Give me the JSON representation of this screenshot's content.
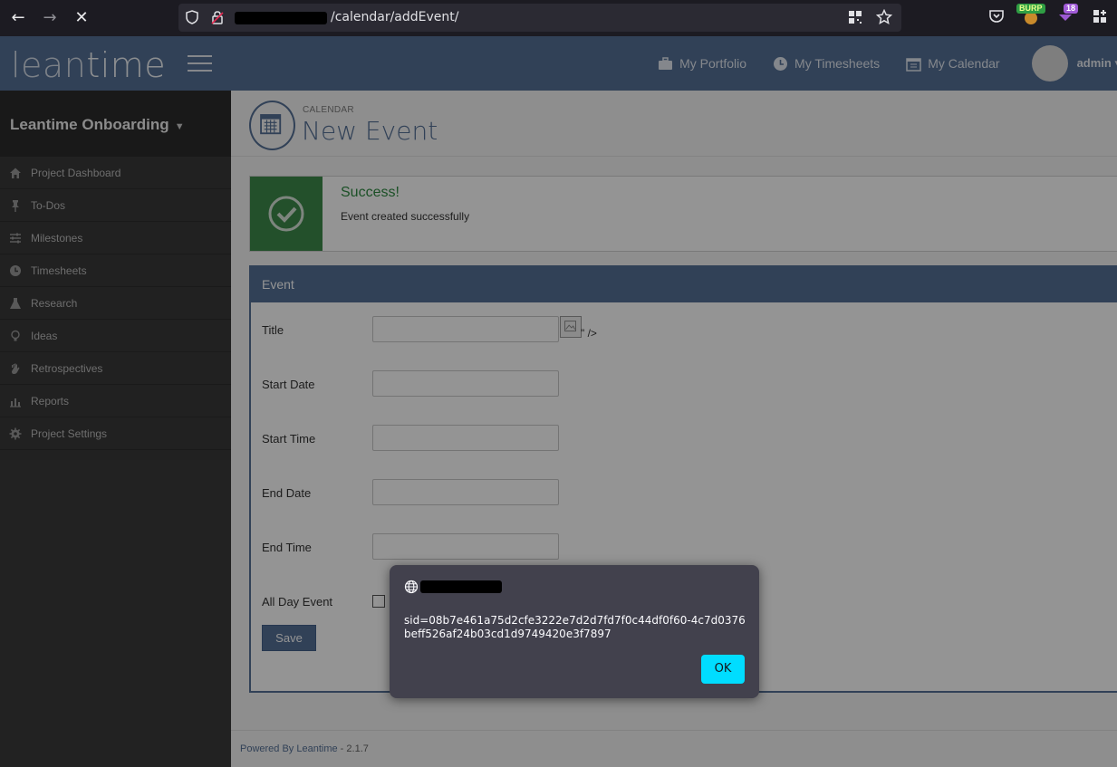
{
  "browser": {
    "url_path": "/calendar/addEvent/",
    "extension_badges": {
      "burp": "BURP",
      "notifications": "18"
    }
  },
  "header": {
    "logo_lean": "lean",
    "logo_time": "time",
    "links": [
      {
        "label": "My Portfolio",
        "icon": "briefcase-icon"
      },
      {
        "label": "My Timesheets",
        "icon": "clock-icon"
      },
      {
        "label": "My Calendar",
        "icon": "calendar-icon"
      }
    ],
    "user": "admin"
  },
  "sidebar": {
    "project": "Leantime Onboarding",
    "items": [
      {
        "label": "Project Dashboard",
        "icon": "home-icon"
      },
      {
        "label": "To-Dos",
        "icon": "pin-icon"
      },
      {
        "label": "Milestones",
        "icon": "sliders-icon"
      },
      {
        "label": "Timesheets",
        "icon": "clock-icon"
      },
      {
        "label": "Research",
        "icon": "flask-icon"
      },
      {
        "label": "Ideas",
        "icon": "lightbulb-icon"
      },
      {
        "label": "Retrospectives",
        "icon": "hand-icon"
      },
      {
        "label": "Reports",
        "icon": "bar-chart-icon"
      },
      {
        "label": "Project Settings",
        "icon": "gear-icon"
      }
    ]
  },
  "page": {
    "breadcrumb": "CALENDAR",
    "title": "New Event"
  },
  "alert": {
    "title": "Success!",
    "message": "Event created successfully",
    "close": "×",
    "color": "#3d8b4a"
  },
  "form": {
    "panel_title": "Event",
    "stray_text": "\" />",
    "fields": [
      {
        "label": "Title",
        "value": ""
      },
      {
        "label": "Start Date",
        "value": ""
      },
      {
        "label": "Start Time",
        "value": ""
      },
      {
        "label": "End Date",
        "value": ""
      },
      {
        "label": "End Time",
        "value": ""
      }
    ],
    "all_day_label": "All Day Event",
    "save_label": "Save"
  },
  "footer": {
    "powered_by": "Powered By Leantime",
    "version": " - 2.1.7"
  },
  "dialog": {
    "message": "sid=08b7e461a75d2cfe3222e7d2d7fd7f0c44df0f60-4c7d0376beff526af24b03cd1d9749420e3f7897",
    "ok_label": "OK",
    "accent": "#00ddff"
  },
  "theme": {
    "primary": "#557096",
    "sidebar": "#3a3a3a"
  }
}
